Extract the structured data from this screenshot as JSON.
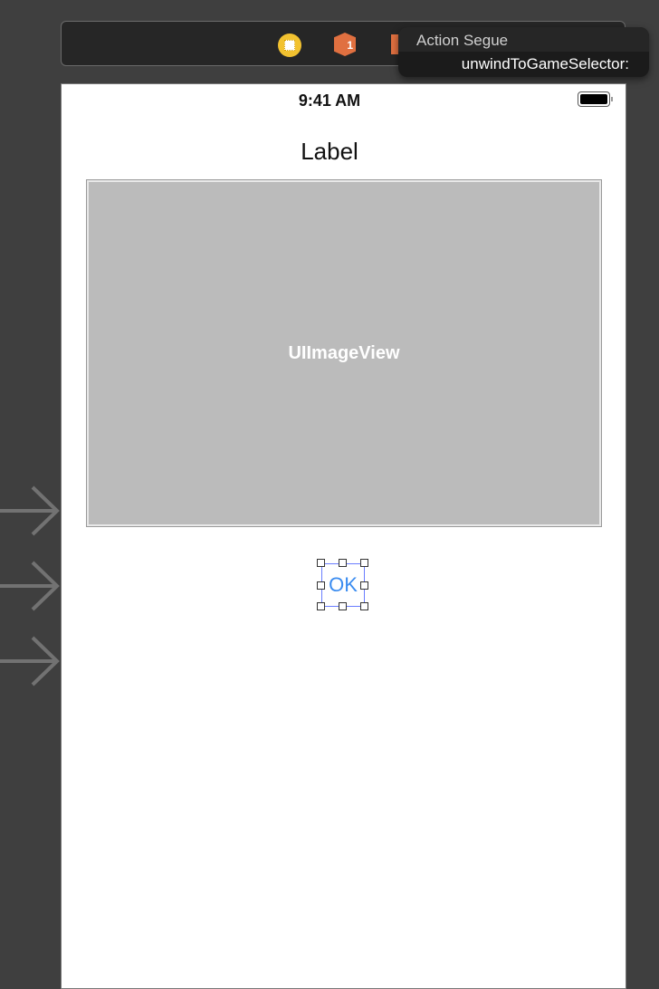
{
  "toolbar": {
    "icons": [
      "view-controller-icon",
      "first-responder-icon",
      "exit-icon"
    ],
    "first_responder_badge": "1"
  },
  "popup": {
    "title": "Action Segue",
    "item": "unwindToGameSelector:"
  },
  "status_bar": {
    "time": "9:41 AM"
  },
  "scene": {
    "label": "Label",
    "image_view": "UIImageView",
    "button": "OK"
  },
  "colors": {
    "accent": "#3b8cf0",
    "selection": "#6a7dff",
    "image_view_bg": "#bbbbbb"
  }
}
